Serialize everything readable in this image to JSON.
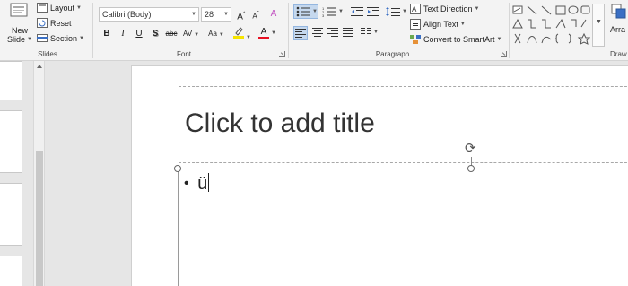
{
  "slides_group": {
    "new_slide_line1": "New",
    "new_slide_line2": "Slide",
    "layout": "Layout",
    "reset": "Reset",
    "section": "Section",
    "label": "Slides"
  },
  "font_group": {
    "font_name": "Calibri (Body)",
    "font_size": "28",
    "bold": "B",
    "italic": "I",
    "underline": "U",
    "strikethrough": "S",
    "shadow": "abc",
    "spacing": "AV",
    "change_case": "Aa",
    "grow": "A",
    "shrink": "A",
    "clear": "A",
    "font_color": "A",
    "highlight_color": "#f5e400",
    "font_color_value": "#e81123",
    "label": "Font"
  },
  "paragraph_group": {
    "text_direction": "Text Direction",
    "align_text": "Align Text",
    "convert_smartart": "Convert to SmartArt",
    "label": "Paragraph"
  },
  "drawing_group": {
    "arrange_partial": "Arra",
    "label_partial": "Draw"
  },
  "slide": {
    "title_placeholder": "Click to add title",
    "bullet_text": "ü",
    "bullet_char": "•"
  }
}
